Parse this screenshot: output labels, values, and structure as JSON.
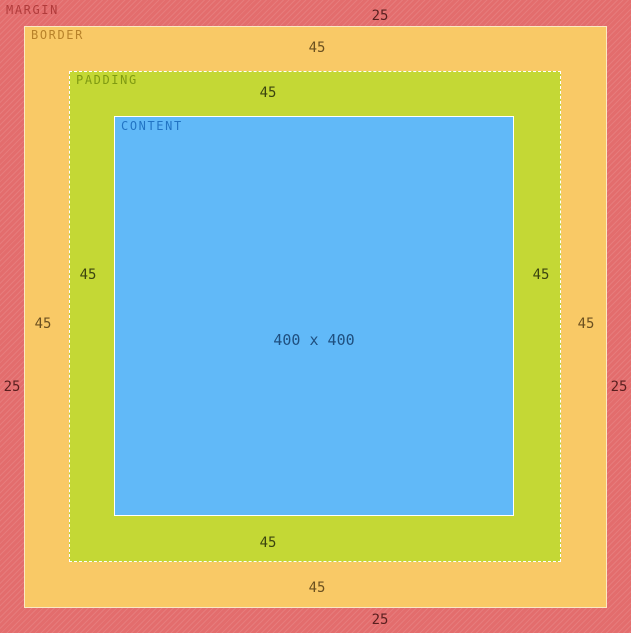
{
  "margin": {
    "label": "MARGIN",
    "top": "25",
    "right": "25",
    "bottom": "25",
    "left": "25"
  },
  "border": {
    "label": "BORDER",
    "top": "45",
    "right": "45",
    "bottom": "45",
    "left": "45"
  },
  "padding": {
    "label": "PADDING",
    "top": "45",
    "right": "45",
    "bottom": "45",
    "left": "45"
  },
  "content": {
    "label": "CONTENT",
    "size": "400 x 400"
  },
  "colors": {
    "margin": "#e36d6d",
    "border": "#f9c966",
    "padding": "#c4d835",
    "content": "#61b9f8"
  }
}
